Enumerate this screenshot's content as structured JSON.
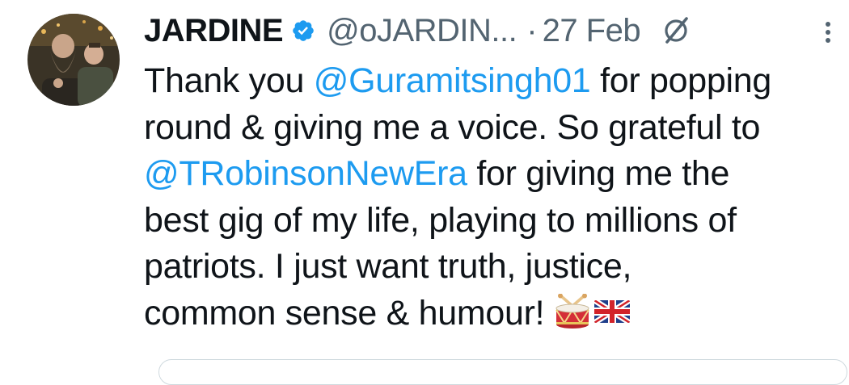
{
  "tweet": {
    "author": {
      "display_name": "JARDINE",
      "handle": "@oJARDIN...",
      "verified": true,
      "avatar_icon": "avatar-photo"
    },
    "separator": "·",
    "date": "27 Feb",
    "icons": {
      "verified": "verified-badge-icon",
      "grok": "grok-icon",
      "more": "more-vertical-icon"
    },
    "colors": {
      "text": "#0f1419",
      "secondary": "#536471",
      "link": "#1d9bf0"
    },
    "text": {
      "l1_a": "Thank you ",
      "l1_mention": "@Guramitsingh01",
      "l1_b": " for popping",
      "l2": "round & giving me a voice. So grateful to",
      "l3_mention": "@TRobinsonNewEra",
      "l3_b": " for giving me the",
      "l4": "best gig of my life, playing to millions of",
      "l5": "patriots. I just want truth, justice,",
      "l6": "common sense & humour! "
    },
    "emojis": [
      "drum",
      "union-jack-flag"
    ]
  }
}
